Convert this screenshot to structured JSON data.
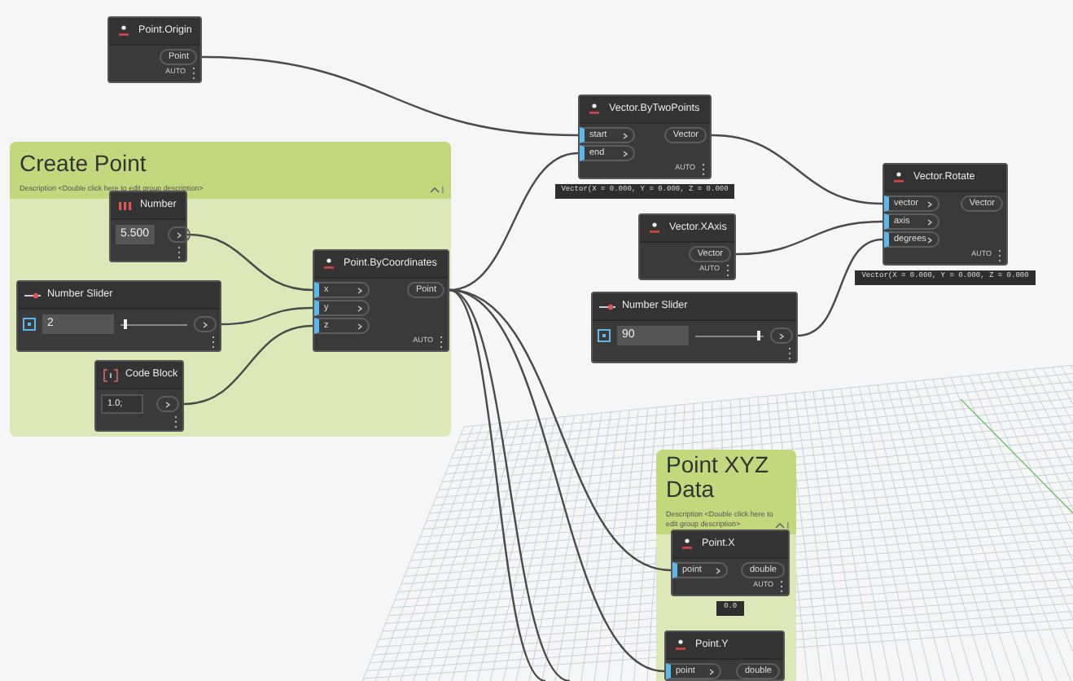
{
  "groups": [
    {
      "title": "Create Point",
      "description": "Description <Double click here to edit group description>"
    },
    {
      "title": "Point XYZ Data",
      "description": "Description <Double click here to edit group description>"
    }
  ],
  "nodes": [
    {
      "kind": "function",
      "title": "Point.Origin",
      "outputs": [
        "Point"
      ],
      "lacing": "AUTO"
    },
    {
      "kind": "number",
      "title": "Number",
      "value": "5.500"
    },
    {
      "kind": "slider",
      "title": "Number Slider",
      "value": "2",
      "level": 0.04
    },
    {
      "kind": "code",
      "title": "Code Block",
      "code": "1.0;"
    },
    {
      "kind": "function",
      "title": "Point.ByCoordinates",
      "inputs": [
        {
          "label": "x",
          "connected": true
        },
        {
          "label": "y",
          "connected": true
        },
        {
          "label": "z",
          "connected": true
        }
      ],
      "outputs": [
        "Point"
      ],
      "lacing": "AUTO"
    },
    {
      "kind": "function",
      "title": "Vector.ByTwoPoints",
      "inputs": [
        {
          "label": "start",
          "connected": true
        },
        {
          "label": "end",
          "connected": true
        }
      ],
      "outputs": [
        "Vector"
      ],
      "lacing": "AUTO",
      "preview": "Vector(X = 0.000, Y = 0.000, Z = 0.000"
    },
    {
      "kind": "function",
      "title": "Vector.XAxis",
      "outputs": [
        "Vector"
      ],
      "lacing": "AUTO"
    },
    {
      "kind": "function",
      "title": "Vector.Rotate",
      "inputs": [
        {
          "label": "vector",
          "connected": true
        },
        {
          "label": "axis",
          "connected": true
        },
        {
          "label": "degrees",
          "connected": true
        }
      ],
      "outputs": [
        "Vector"
      ],
      "lacing": "AUTO",
      "preview": "Vector(X = 0.000, Y = 0.000, Z = 0.000"
    },
    {
      "kind": "slider",
      "title": "Number Slider",
      "value": "90",
      "level": 0.9
    },
    {
      "kind": "function",
      "title": "Point.X",
      "inputs": [
        {
          "label": "point",
          "connected": true
        }
      ],
      "outputs": [
        "double"
      ],
      "lacing": "AUTO",
      "preview": "0.0"
    },
    {
      "kind": "function",
      "title": "Point.Y",
      "inputs": [
        {
          "label": "point",
          "connected": true
        }
      ],
      "outputs": [
        "double"
      ]
    }
  ]
}
